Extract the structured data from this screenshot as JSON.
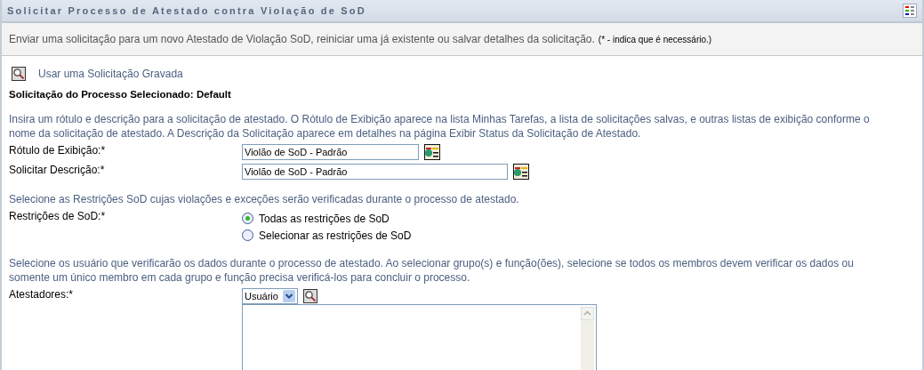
{
  "header": {
    "title": "Solicitar Processo de Atestado contra Violação de SoD"
  },
  "intro": {
    "text": "Enviar uma solicitação para um novo Atestado de Violação SoD, reiniciar uma já existente ou salvar detalhes da solicitação.",
    "required_note": "(* - indica que é necessário.)"
  },
  "saved_request_link": "Usar uma Solicitação Gravada",
  "selected_process": "Solicitação do Processo Selecionado: Default",
  "sections": [
    {
      "instructions": "Insira um rótulo e descrição para a solicitação de atestado. O Rótulo de Exibição aparece na lista Minhas Tarefas, a lista de solicitações salvas, e outras listas de exibição conforme o nome da solicitação de atestado. A Descrição da Solicitação aparece em detalhes na página Exibir Status da Solicitação de Atestado.",
      "fields": [
        {
          "kind": "text",
          "label": "Rótulo de Exibição:*",
          "value": "Violão de SoD - Padrão",
          "wide": false
        },
        {
          "kind": "text",
          "label": "Solicitar Descrição:*",
          "value": "Violão de SoD - Padrão",
          "wide": true
        }
      ]
    },
    {
      "instructions": "Selecione as Restrições SoD cujas violações e exceções serão verificadas durante o processo de atestado.",
      "fields": [
        {
          "kind": "radio",
          "label": "Restrições de SoD:*",
          "options": [
            {
              "label": "Todas as restrições de SoD",
              "selected": true
            },
            {
              "label": "Selecionar as restrições de SoD",
              "selected": false
            }
          ]
        }
      ]
    },
    {
      "instructions": "Selecione os usuário que verificarão os dados durante o processo de atestado. Ao selecionar grupo(s) e função(ões), selecione se todos os membros devem verificar os dados ou somente um único membro em cada grupo e função precisa verificá-los para concluir o processo.",
      "fields": [
        {
          "kind": "picker",
          "label": "Atestadores:*",
          "type_value": "Usuário"
        }
      ]
    }
  ]
}
